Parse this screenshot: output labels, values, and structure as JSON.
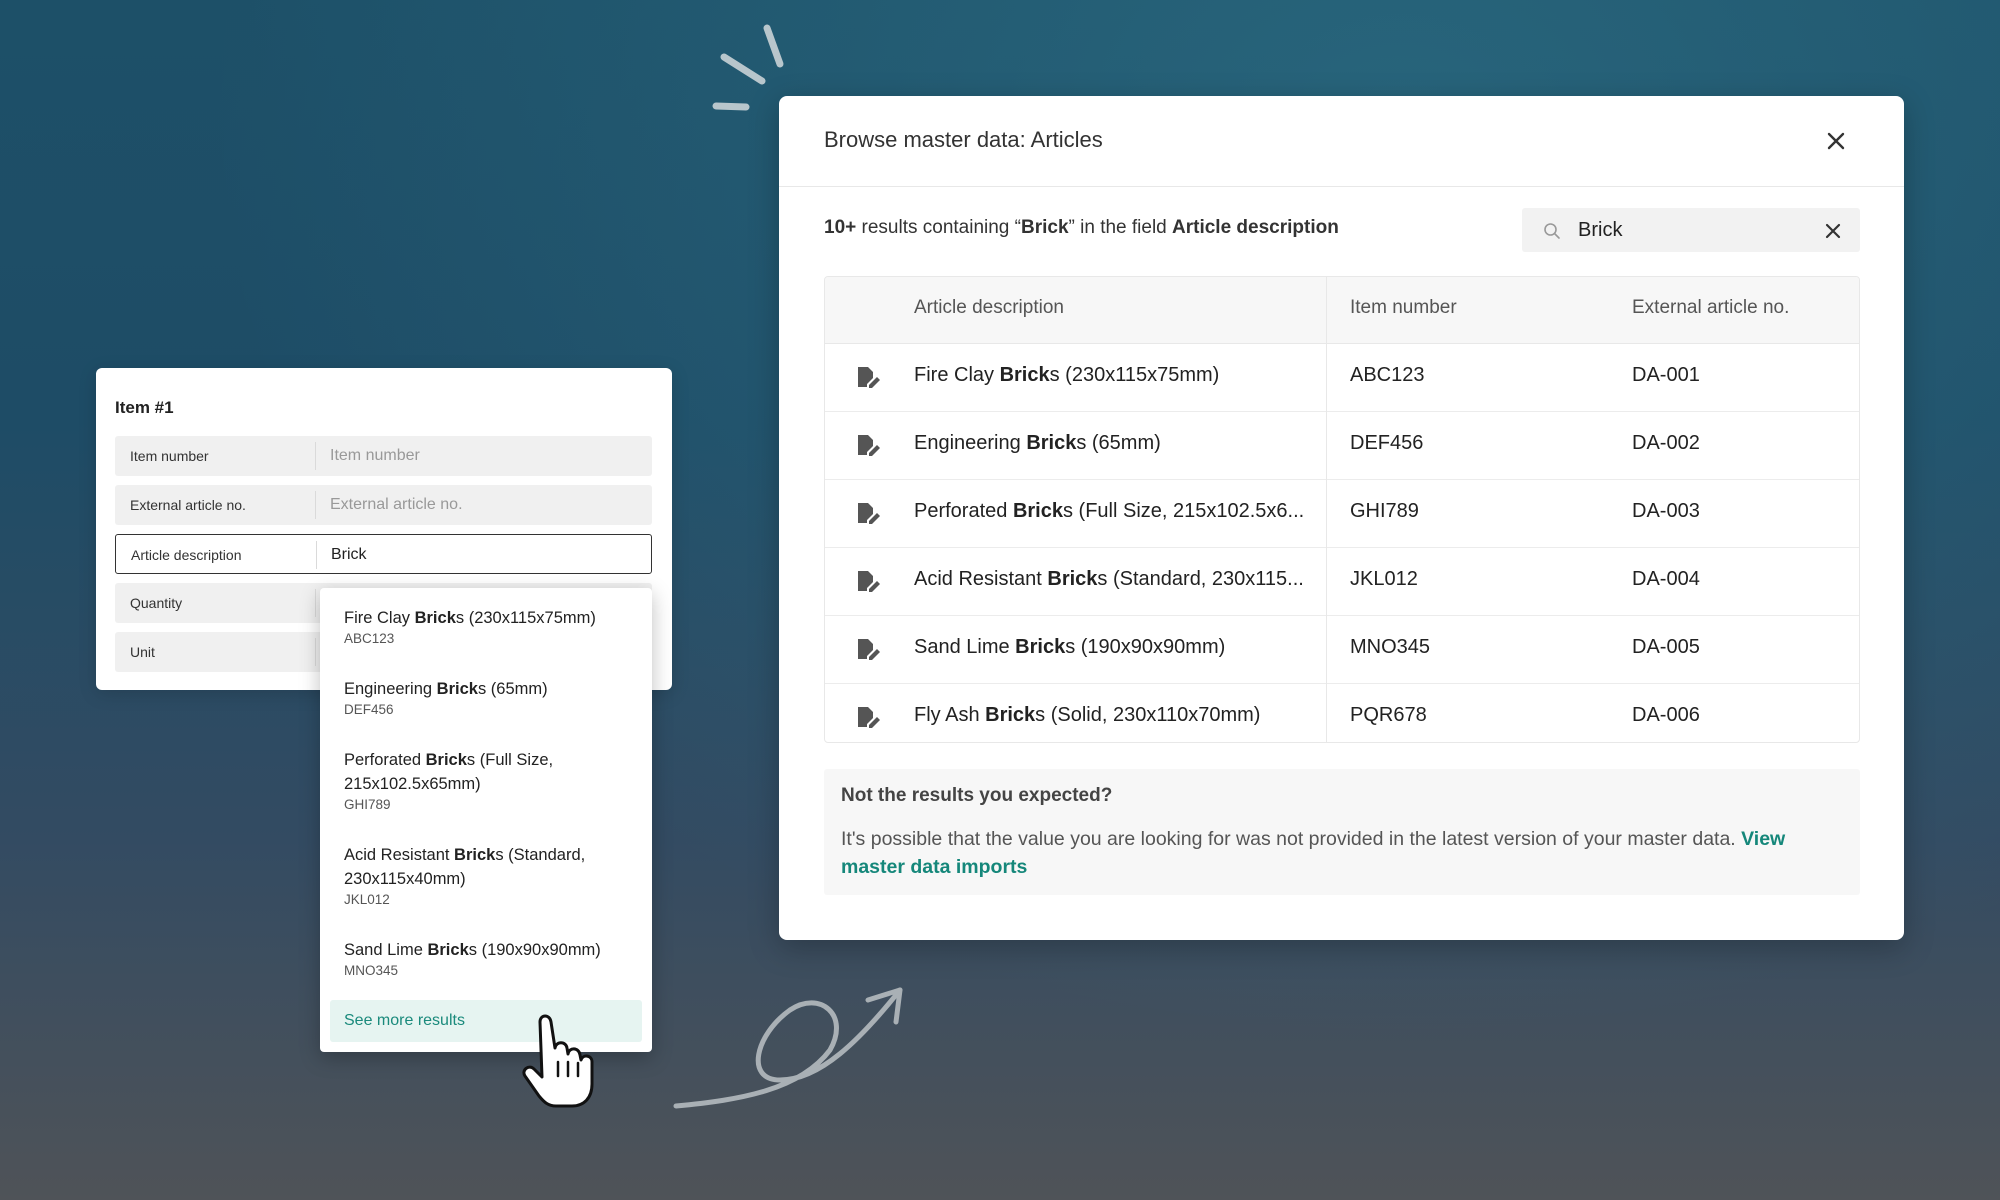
{
  "form": {
    "title": "Item #1",
    "fields": [
      {
        "label": "Item number",
        "value": "",
        "placeholder": "Item number"
      },
      {
        "label": "External article no.",
        "value": "",
        "placeholder": "External article no."
      },
      {
        "label": "Article description",
        "value": "Brick",
        "placeholder": ""
      },
      {
        "label": "Quantity",
        "value": "",
        "placeholder": ""
      },
      {
        "label": "Unit",
        "value": "",
        "placeholder": ""
      }
    ]
  },
  "dropdown": {
    "items": [
      {
        "pre": "Fire Clay ",
        "match": "Brick",
        "post": "s (230x115x75mm)",
        "code": "ABC123"
      },
      {
        "pre": "Engineering ",
        "match": "Brick",
        "post": "s (65mm)",
        "code": "DEF456"
      },
      {
        "pre": "Perforated ",
        "match": "Brick",
        "post": "s (Full Size,",
        "post2": "215x102.5x65mm)",
        "code": "GHI789"
      },
      {
        "pre": "Acid Resistant ",
        "match": "Brick",
        "post": "s (Standard,",
        "post2": "230x115x40mm)",
        "code": "JKL012"
      },
      {
        "pre": "Sand Lime ",
        "match": "Brick",
        "post": "s (190x90x90mm)",
        "code": "MNO345"
      }
    ],
    "see_more": "See more results"
  },
  "modal": {
    "title": "Browse master data: Articles",
    "summary": {
      "count": "10+",
      "text1": " results containing “",
      "term": "Brick",
      "text2": "” in the field ",
      "field": "Article description"
    },
    "search": {
      "value": "Brick"
    },
    "columns": [
      "Article description",
      "Item number",
      "External article no."
    ],
    "rows": [
      {
        "pre": "Fire Clay ",
        "match": "Brick",
        "post": "s (230x115x75mm)",
        "item": "ABC123",
        "ext": "DA-001"
      },
      {
        "pre": "Engineering ",
        "match": "Brick",
        "post": "s (65mm)",
        "item": "DEF456",
        "ext": "DA-002"
      },
      {
        "pre": "Perforated ",
        "match": "Brick",
        "post": "s (Full Size, 215x102.5x6...",
        "item": "GHI789",
        "ext": "DA-003"
      },
      {
        "pre": "Acid Resistant ",
        "match": "Brick",
        "post": "s (Standard, 230x115...",
        "item": "JKL012",
        "ext": "DA-004"
      },
      {
        "pre": "Sand Lime ",
        "match": "Brick",
        "post": "s (190x90x90mm)",
        "item": "MNO345",
        "ext": "DA-005"
      },
      {
        "pre": "Fly Ash ",
        "match": "Brick",
        "post": "s (Solid, 230x110x70mm)",
        "item": "PQR678",
        "ext": "DA-006"
      }
    ],
    "note": {
      "title": "Not the results you expected?",
      "body": "It's possible that the value you are looking for was not provided in the latest version of your master data. ",
      "link": "View master data imports"
    }
  },
  "colors": {
    "accent": "#15877a",
    "accent_bg": "#e6f4f1"
  }
}
